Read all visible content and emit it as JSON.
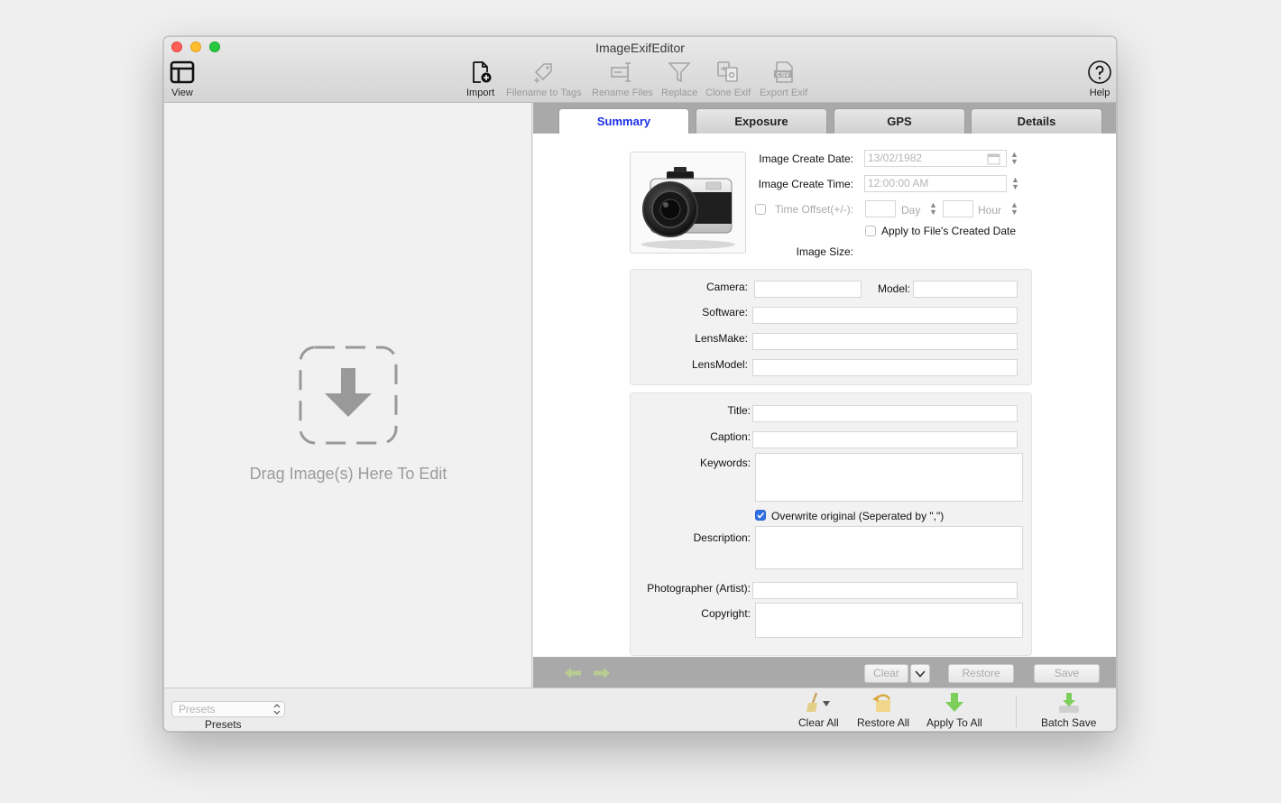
{
  "window": {
    "title": "ImageExifEditor"
  },
  "toolbar": {
    "view": "View",
    "import": "Import",
    "filename_to_tags": "Filename to Tags",
    "rename_files": "Rename Files",
    "replace": "Replace",
    "clone_exif": "Clone Exif",
    "export_exif": "Export Exif",
    "help": "Help",
    "export_badge": "CSV"
  },
  "left_pane": {
    "drop_text": "Drag Image(s) Here To Edit"
  },
  "tabs": [
    {
      "label": "Summary",
      "active": true
    },
    {
      "label": "Exposure",
      "active": false
    },
    {
      "label": "GPS",
      "active": false
    },
    {
      "label": "Details",
      "active": false
    }
  ],
  "summary": {
    "create_date_label": "Image Create Date:",
    "create_date_value": "13/02/1982",
    "create_time_label": "Image Create Time:",
    "create_time_value": "12:00:00 AM",
    "time_offset_label": "Time Offset(+/-):",
    "day_label": "Day",
    "hour_label": "Hour",
    "apply_file_date_label": "Apply to File's Created Date",
    "image_size_label": "Image Size:"
  },
  "camera_group": {
    "camera_label": "Camera:",
    "model_label": "Model:",
    "software_label": "Software:",
    "lensmake_label": "LensMake:",
    "lensmodel_label": "LensModel:"
  },
  "meta_group": {
    "title_label": "Title:",
    "caption_label": "Caption:",
    "keywords_label": "Keywords:",
    "overwrite_label": "Overwrite original (Seperated by \",\")",
    "overwrite_checked": true,
    "description_label": "Description:",
    "photographer_label": "Photographer (Artist):",
    "copyright_label": "Copyright:"
  },
  "action_bar": {
    "clear": "Clear",
    "restore": "Restore",
    "save": "Save"
  },
  "footer": {
    "presets_popup": "Presets",
    "presets_label": "Presets",
    "clear_all": "Clear All",
    "restore_all": "Restore All",
    "apply_to_all": "Apply To All",
    "batch_save": "Batch Save"
  },
  "colors": {
    "active_tab_text": "#1a2ee6",
    "checkbox_checked": "#2f6fe4"
  }
}
